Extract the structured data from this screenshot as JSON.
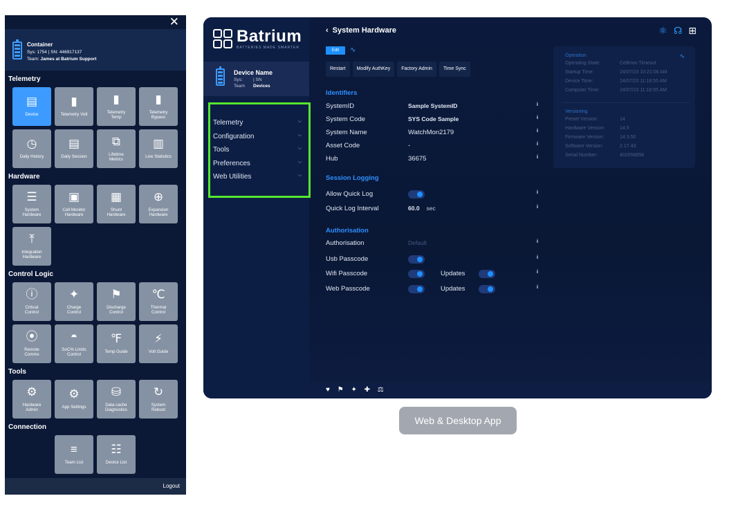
{
  "mobile": {
    "close": "✕",
    "container": {
      "title": "Container",
      "sys_line": "Sys: 1754 | SN: 446917137",
      "team_prefix": "Team: ",
      "team_name": "James at Batrium Support"
    },
    "sections": [
      {
        "label": "Telemetry",
        "tiles": [
          {
            "label": "Device",
            "icon": "▤",
            "icon_name": "battery-icon",
            "active": true
          },
          {
            "label": "Telemetry Volt",
            "icon": "▮",
            "icon_name": "battery-volt-icon"
          },
          {
            "label": "Telemetry\nTemp",
            "icon": "▮",
            "icon_name": "battery-temp-icon"
          },
          {
            "label": "Telemetry\nBypass",
            "icon": "▮",
            "icon_name": "battery-bypass-icon"
          },
          {
            "label": "Daily History",
            "icon": "◷",
            "icon_name": "history-icon"
          },
          {
            "label": "Daily Session",
            "icon": "▤",
            "icon_name": "session-icon"
          },
          {
            "label": "Lifetime\nMetrics",
            "icon": "⧉",
            "icon_name": "lifetime-icon"
          },
          {
            "label": "Live Statistics",
            "icon": "▥",
            "icon_name": "statistics-icon"
          }
        ]
      },
      {
        "label": "Hardware",
        "tiles": [
          {
            "label": "System\nHardware",
            "icon": "☰",
            "icon_name": "sliders-icon"
          },
          {
            "label": "Cell Monitor\nHardware",
            "icon": "▣",
            "icon_name": "cell-monitor-icon"
          },
          {
            "label": "Shunt\nHardware",
            "icon": "▦",
            "icon_name": "shunt-icon"
          },
          {
            "label": "Expansion\nHardware",
            "icon": "⊕",
            "icon_name": "expansion-icon"
          },
          {
            "label": "Integration\nHardware",
            "icon": "⤒",
            "icon_name": "integration-icon"
          }
        ]
      },
      {
        "label": "Control Logic",
        "tiles": [
          {
            "label": "Critical\nControl",
            "icon": "ⓘ",
            "icon_name": "critical-icon"
          },
          {
            "label": "Charge\nControl",
            "icon": "✦",
            "icon_name": "charge-plug-icon"
          },
          {
            "label": "Discharge\nControl",
            "icon": "⚑",
            "icon_name": "discharge-runner-icon"
          },
          {
            "label": "Thermal\nControl",
            "icon": "℃",
            "icon_name": "thermometer-icon"
          },
          {
            "label": "Remote\nComms",
            "icon": "⦿",
            "icon_name": "remote-icon"
          },
          {
            "label": "SoC% Limits\nControl",
            "icon": "◓",
            "icon_name": "gauge-icon"
          },
          {
            "label": "Temp Guide",
            "icon": "℉",
            "icon_name": "temp-guide-icon"
          },
          {
            "label": "Volt Guide",
            "icon": "⚡",
            "icon_name": "bolt-icon"
          }
        ]
      },
      {
        "label": "Tools",
        "tiles": [
          {
            "label": "Hardware\nAdmin",
            "icon": "⚙",
            "icon_name": "admin-icon"
          },
          {
            "label": "App Settings",
            "icon": "⚙",
            "icon_name": "gears-icon"
          },
          {
            "label": "Data cache\nDiagnostics",
            "icon": "⛁",
            "icon_name": "database-icon"
          },
          {
            "label": "System\nReboot",
            "icon": "↻",
            "icon_name": "reboot-icon"
          }
        ]
      },
      {
        "label": "Connection",
        "tiles": [
          {
            "label": "",
            "icon": "",
            "icon_name": "",
            "empty": true
          },
          {
            "label": "Team List",
            "icon": "≡",
            "icon_name": "list-icon"
          },
          {
            "label": "Device List",
            "icon": "☷",
            "icon_name": "device-list-icon"
          }
        ]
      }
    ],
    "logout": "Logout"
  },
  "desktop": {
    "logo": {
      "name": "Batrium",
      "tagline": "BATTERIES MADE SMARTER"
    },
    "device": {
      "name": "Device Name",
      "sys_label": "Sys:",
      "sys_value": "| SN",
      "team_label": "Team",
      "team_value": "Devices"
    },
    "nav": [
      "Telemetry",
      "Configuration",
      "Tools",
      "Preferences",
      "Web Utilities"
    ],
    "title": "System Hardware",
    "edit": "Edit",
    "toolbar": [
      "Restart",
      "Modify AuthKey",
      "Factory Admin",
      "Time Sync"
    ],
    "identifiers": {
      "heading": "Identifiers",
      "rows": [
        {
          "label": "SystemID",
          "value": "Sample SystemID",
          "bold": true
        },
        {
          "label": "System Code",
          "value": "SYS Code Sample",
          "bold": true
        },
        {
          "label": "System Name",
          "value": "WatchMon2179"
        },
        {
          "label": "Asset Code",
          "value": "-"
        },
        {
          "label": "Hub",
          "value": "36675"
        }
      ]
    },
    "session_logging": {
      "heading": "Session Logging",
      "allow_quick_log": "Allow Quick Log",
      "quick_log_interval": "Quick Log Interval",
      "interval_value": "60.0",
      "interval_unit": "sec"
    },
    "authorisation": {
      "heading": "Authorisation",
      "auth_label": "Authorisation",
      "auth_value": "Default",
      "usb": "Usb Passcode",
      "wifi": "Wifi Passcode",
      "web": "Web Passcode",
      "updates": "Updates"
    },
    "info_panel": {
      "operation_heading": "Operation",
      "operation": [
        {
          "label": "Operating State:",
          "value": "Cellmon Timeout"
        },
        {
          "label": "Startup Time:",
          "value": "24/07/23  10:21:06 AM"
        },
        {
          "label": "Device Time:",
          "value": "24/07/23  11:18:55 AM"
        },
        {
          "label": "Computer Time:",
          "value": "24/07/23  11:18:55 AM"
        }
      ],
      "versioning_heading": "Versioning",
      "versioning": [
        {
          "label": "Preset Version:",
          "value": "14"
        },
        {
          "label": "Hardware Version:",
          "value": "14.5"
        },
        {
          "label": "Firmware Version:",
          "value": "14.3.50"
        },
        {
          "label": "Software Version:",
          "value": "2.17.43"
        },
        {
          "label": "Serial Number:",
          "value": "402056858"
        }
      ]
    },
    "bottom_icons": "♥ ⚑ ✦ ✚ ⚖"
  },
  "caption": "Web & Desktop App"
}
